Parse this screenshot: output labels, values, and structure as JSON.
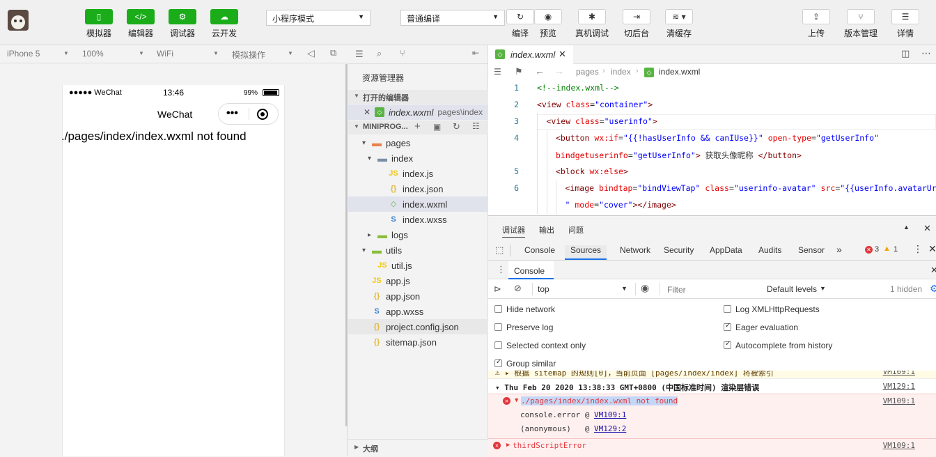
{
  "toolbar": {
    "left_buttons": [
      {
        "icon": "phone-icon",
        "glyph": "▯",
        "label": "模拟器"
      },
      {
        "icon": "code-icon",
        "glyph": "</>",
        "label": "编辑器"
      },
      {
        "icon": "debug-icon",
        "glyph": "⚙",
        "label": "调试器"
      },
      {
        "icon": "cloud-icon",
        "glyph": "☁",
        "label": "云开发"
      }
    ],
    "mode_select": "小程序模式",
    "compile_select": "普通编译",
    "mid_buttons": [
      {
        "icon": "refresh-icon",
        "glyph": "↻",
        "label": "编译"
      },
      {
        "icon": "eye-icon",
        "glyph": "◉",
        "label": "预览"
      },
      {
        "icon": "bug-icon",
        "glyph": "✱",
        "label": "真机调试"
      },
      {
        "icon": "switch-icon",
        "glyph": "⇥",
        "label": "切后台"
      },
      {
        "icon": "layers-icon",
        "glyph": "≋ ▾",
        "label": "清缓存"
      }
    ],
    "right_buttons": [
      {
        "icon": "upload-icon",
        "glyph": "⇪",
        "label": "上传"
      },
      {
        "icon": "branch-icon",
        "glyph": "⑂",
        "label": "版本管理"
      },
      {
        "icon": "menu-icon",
        "glyph": "☰",
        "label": "详情"
      }
    ]
  },
  "simulator": {
    "device": "iPhone 5",
    "zoom": "100%",
    "network": "WiFi",
    "operation": "模拟操作",
    "status_carrier": "●●●●● WeChat",
    "status_time": "13:46",
    "status_battery": "99%",
    "nav_title": "WeChat",
    "capsule_dots": "•••",
    "error_text": "./pages/index/index.wxml not found"
  },
  "explorer": {
    "title": "资源管理器",
    "open_editors_label": "打开的编辑器",
    "open_file": "index.wxml",
    "open_file_path": "pages\\index",
    "project_label": "MINIPROG...",
    "outline_label": "大纲",
    "tree": [
      {
        "name": "pages",
        "type": "folder-orange",
        "indent": 1,
        "arrow": "▾"
      },
      {
        "name": "index",
        "type": "folder-blue",
        "indent": 2,
        "arrow": "▾"
      },
      {
        "name": "index.js",
        "type": "js",
        "indent": 3,
        "arrow": ""
      },
      {
        "name": "index.json",
        "type": "json",
        "indent": 3,
        "arrow": ""
      },
      {
        "name": "index.wxml",
        "type": "wxml",
        "indent": 3,
        "arrow": "",
        "selected": true
      },
      {
        "name": "index.wxss",
        "type": "wxss",
        "indent": 3,
        "arrow": ""
      },
      {
        "name": "logs",
        "type": "folder-green",
        "indent": 2,
        "arrow": "▸"
      },
      {
        "name": "utils",
        "type": "folder-green",
        "indent": 1,
        "arrow": "▾"
      },
      {
        "name": "util.js",
        "type": "js",
        "indent": 2,
        "arrow": ""
      },
      {
        "name": "app.js",
        "type": "js",
        "indent": 1,
        "arrow": ""
      },
      {
        "name": "app.json",
        "type": "json",
        "indent": 1,
        "arrow": ""
      },
      {
        "name": "app.wxss",
        "type": "wxss",
        "indent": 1,
        "arrow": ""
      },
      {
        "name": "project.config.json",
        "type": "json",
        "indent": 1,
        "arrow": "",
        "hover": true
      },
      {
        "name": "sitemap.json",
        "type": "json",
        "indent": 1,
        "arrow": ""
      }
    ]
  },
  "editor": {
    "tab_name": "index.wxml",
    "breadcrumb": [
      "pages",
      "index",
      "index.wxml"
    ],
    "lines": [
      {
        "n": "1",
        "parts": [
          [
            "cmt",
            "<!--index.wxml-->"
          ]
        ],
        "indent": 0
      },
      {
        "n": "2",
        "parts": [
          [
            "tag",
            "<view "
          ],
          [
            "attr",
            "class"
          ],
          [
            "",
            "="
          ],
          [
            "str",
            "\"container\""
          ],
          [
            "tag",
            ">"
          ]
        ],
        "indent": 0
      },
      {
        "n": "3",
        "parts": [
          [
            "tag",
            "<view "
          ],
          [
            "attr",
            "class"
          ],
          [
            "",
            "="
          ],
          [
            "str",
            "\"userinfo\""
          ],
          [
            "tag",
            ">"
          ]
        ],
        "indent": 1
      },
      {
        "n": "4",
        "parts": [
          [
            "tag",
            "<button "
          ],
          [
            "attr",
            "wx:if"
          ],
          [
            "",
            "="
          ],
          [
            "str",
            "\"{{!hasUserInfo && canIUse}}\""
          ],
          [
            "",
            " "
          ],
          [
            "attr",
            "open-type"
          ],
          [
            "",
            "="
          ],
          [
            "str",
            "\"getUserInfo\""
          ]
        ],
        "indent": 2
      },
      {
        "n": "",
        "parts": [
          [
            "attr",
            "bindgetuserinfo"
          ],
          [
            "",
            "="
          ],
          [
            "str",
            "\"getUserInfo\""
          ],
          [
            "tag",
            ">"
          ],
          [
            "",
            " 获取头像昵称 "
          ],
          [
            "tag",
            "</button>"
          ]
        ],
        "indent": 2
      },
      {
        "n": "5",
        "parts": [
          [
            "tag",
            "<block "
          ],
          [
            "attr",
            "wx:else"
          ],
          [
            "tag",
            ">"
          ]
        ],
        "indent": 2
      },
      {
        "n": "6",
        "parts": [
          [
            "tag",
            "<image "
          ],
          [
            "attr",
            "bindtap"
          ],
          [
            "",
            "="
          ],
          [
            "str",
            "\"bindViewTap\""
          ],
          [
            "",
            " "
          ],
          [
            "attr",
            "class"
          ],
          [
            "",
            "="
          ],
          [
            "str",
            "\"userinfo-avatar\""
          ],
          [
            "",
            " "
          ],
          [
            "attr",
            "src"
          ],
          [
            "",
            "="
          ],
          [
            "str",
            "\"{{userInfo.avatarUrl}}"
          ]
        ],
        "indent": 3
      },
      {
        "n": "",
        "parts": [
          [
            "str",
            "\""
          ],
          [
            "",
            " "
          ],
          [
            "attr",
            "mode"
          ],
          [
            "",
            "="
          ],
          [
            "str",
            "\"cover\""
          ],
          [
            "tag",
            "></image>"
          ]
        ],
        "indent": 3
      }
    ]
  },
  "devtools": {
    "top_tabs": [
      "调试器",
      "输出",
      "问题"
    ],
    "panel_tabs": [
      "Console",
      "Sources",
      "Network",
      "Security",
      "AppData",
      "Audits",
      "Sensor"
    ],
    "active_panel_tab": "Sources",
    "more_tabs": "»",
    "error_count": "3",
    "warning_count": "1",
    "drawer_tab": "Console",
    "context": "top",
    "filter_placeholder": "Filter",
    "levels": "Default levels",
    "hidden": "1 hidden",
    "options_left": [
      {
        "label": "Hide network",
        "checked": false
      },
      {
        "label": "Preserve log",
        "checked": false
      },
      {
        "label": "Selected context only",
        "checked": false
      },
      {
        "label": "Group similar",
        "checked": true
      }
    ],
    "options_right": [
      {
        "label": "Log XMLHttpRequests",
        "checked": false
      },
      {
        "label": "Eager evaluation",
        "checked": true
      },
      {
        "label": "Autocomplete from history",
        "checked": true
      }
    ],
    "logs": {
      "warn_text": "▸ 根据 sitemap 的规则[0]，当前页面 [pages/index/index] 将被索引",
      "warn_src": "VM109:1",
      "group_text": "▾ Thu Feb 20 2020 13:38:33 GMT+0800 (中国标准时间) 渲染层错误",
      "group_src": "VM129:1",
      "err1_text": "./pages/index/index.wxml not found",
      "err1_src": "VM109:1",
      "stack1_fn": "console.error @ ",
      "stack1_src": "VM109:1",
      "stack2_fn": "(anonymous)   @ ",
      "stack2_src": "VM129:2",
      "err2_text": "thirdScriptError",
      "err2_src": "VM109:1"
    }
  }
}
